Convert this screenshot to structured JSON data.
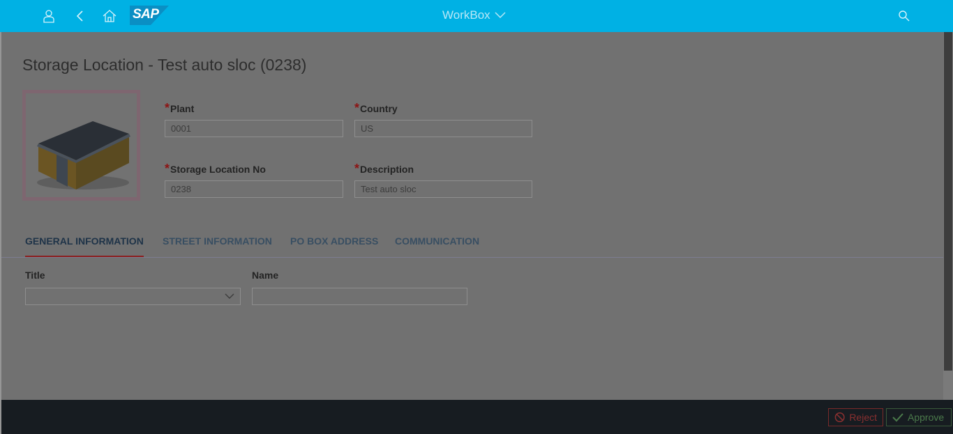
{
  "shell": {
    "brand": "SAP",
    "app_title": "WorkBox",
    "icons": {
      "user": "user-icon",
      "back": "back-icon",
      "home": "home-icon",
      "search": "search-icon",
      "dropdown": "chevron-down-icon"
    },
    "color": "#00b1e4"
  },
  "page": {
    "title": "Storage Location - Test auto sloc (0238)",
    "image": "warehouse-icon"
  },
  "header_fields": {
    "plant": {
      "label": "Plant",
      "value": "0001",
      "required": "*"
    },
    "country": {
      "label": "Country",
      "value": "US",
      "required": "*"
    },
    "storage_location_no": {
      "label": "Storage Location No",
      "value": "0238",
      "required": "*"
    },
    "description": {
      "label": "Description",
      "value": "Test auto sloc",
      "required": "*"
    }
  },
  "tabs": [
    {
      "label": "GENERAL INFORMATION",
      "active": true
    },
    {
      "label": "STREET INFORMATION",
      "active": false
    },
    {
      "label": "PO BOX ADDRESS",
      "active": false
    },
    {
      "label": "COMMUNICATION",
      "active": false
    }
  ],
  "general": {
    "title_label": "Title",
    "title_value": "",
    "name_label": "Name",
    "name_value": ""
  },
  "footer": {
    "reject_label": "Reject",
    "approve_label": "Approve",
    "reject_color": "#8a3030",
    "approve_color": "#4b7a4b"
  }
}
